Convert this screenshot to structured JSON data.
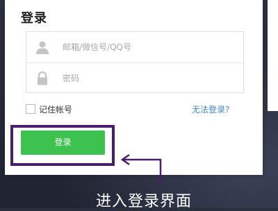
{
  "dialog": {
    "title": "登录",
    "username_placeholder": "邮箱/微信号/QQ号",
    "password_placeholder": "密码",
    "username_icon": "user-icon",
    "password_icon": "lock-icon",
    "remember_label": "记住帐号",
    "remember_checked": false,
    "forgot_link": "无法登录?",
    "login_button": "登录"
  },
  "annotation": {
    "caption": "进入登录界面",
    "highlight_color": "#4a1c6e",
    "arrow_color": "#4a1c6e"
  },
  "colors": {
    "button_green": "#3ec24f",
    "link_blue": "#3d89c9"
  }
}
